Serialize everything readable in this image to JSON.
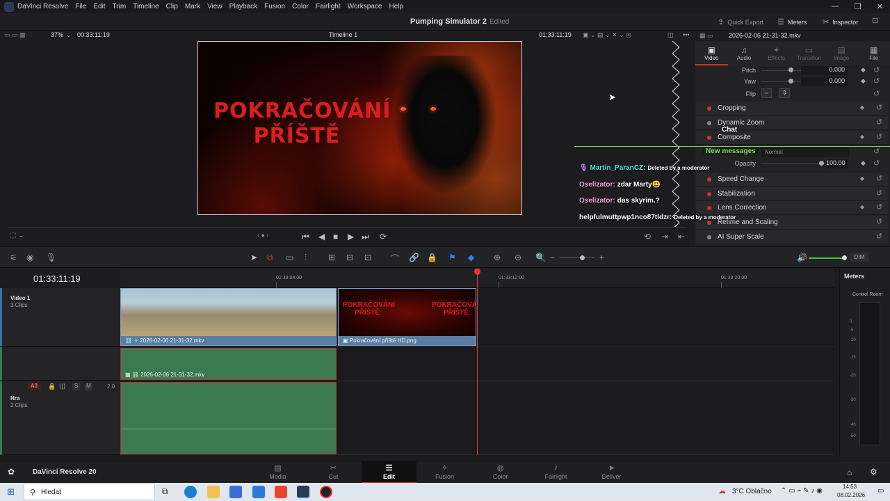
{
  "app": {
    "name": "DaVinci Resolve",
    "menu": [
      "File",
      "Edit",
      "Trim",
      "Timeline",
      "Clip",
      "Mark",
      "View",
      "Playback",
      "Fusion",
      "Color",
      "Fairlight",
      "Workspace",
      "Help"
    ]
  },
  "titlebar": {
    "project": "Pumping Simulator 2",
    "status": "Edited",
    "quick_export": "Quick Export",
    "meters": "Meters",
    "inspector": "Inspector"
  },
  "viewer": {
    "zoom": "37%",
    "timecode_left": "00:33:11:19",
    "timeline_name": "Timeline 1",
    "timecode_right": "01:33:11:19",
    "preview_text_line1": "POKRAČOVÁNÍ",
    "preview_text_line2": "PŘÍŠTĚ"
  },
  "inspector": {
    "clip_name": "2026-02-06 21-31-32.mkv",
    "tabs": [
      {
        "label": "Video",
        "glyph": "▣"
      },
      {
        "label": "Audio",
        "glyph": "♫"
      },
      {
        "label": "Effects",
        "glyph": "✦"
      },
      {
        "label": "Transition",
        "glyph": "▭"
      },
      {
        "label": "Image",
        "glyph": "▤"
      },
      {
        "label": "File",
        "glyph": "▦"
      }
    ],
    "pitch": {
      "label": "Pitch",
      "value": "0.000"
    },
    "yaw": {
      "label": "Yaw",
      "value": "0.000"
    },
    "flip": {
      "label": "Flip"
    },
    "opacity": {
      "label": "Opacity",
      "value": "100.00"
    },
    "composite_mode": "Normal",
    "sections": [
      "Cropping",
      "Dynamic Zoom",
      "Composite",
      "Speed Change",
      "Stabilization",
      "Lens Correction",
      "Retime and Scaling",
      "AI Super Scale"
    ]
  },
  "chat": {
    "title": "Chat",
    "new_messages": "New messages",
    "messages": [
      {
        "user": "Martin_ParanCZ:",
        "text": "Deleted by a moderator",
        "color": "#46e6e6"
      },
      {
        "user": "Oselizator:",
        "text": "zdar Marty😃",
        "color": "#ff9ad5"
      },
      {
        "user": "Oselizator:",
        "text": "das skyrim.?",
        "color": "#ff9ad5"
      },
      {
        "user": "helpfulmuttpwp1nco87tldzr:",
        "text": "Deleted by a moderator",
        "color": "#ffffff"
      }
    ]
  },
  "timeline": {
    "timecode": "01:33:11:19",
    "ruler": [
      "01:33:04:00",
      "01:33:12:00",
      "01:33:20:00"
    ],
    "tracks": [
      {
        "name": "Video 1",
        "count": "3 Clips"
      },
      {
        "name": "Hra",
        "count": "2 Clips",
        "badge": "A3",
        "s": "S",
        "m": "M",
        "level": "2.0"
      }
    ],
    "clips": {
      "v1a": "2026-02-06 21-31-32.mkv",
      "v1b": "Pokračování příště HD.png",
      "a1": "2026-02-06 21-31-32.mkv"
    },
    "thumb_text_line1": "POKRAČOVÁNÍ",
    "thumb_text_line2": "PŘÍŠTĚ"
  },
  "meters_panel": {
    "title": "Meters",
    "control_room": "Control Room",
    "scale": [
      "0",
      "-5",
      "-10",
      "-15",
      "-20",
      "-30",
      "-40",
      "-50"
    ]
  },
  "toolbar": {
    "dim": "DIM"
  },
  "pages": [
    {
      "label": "Media",
      "glyph": "▤"
    },
    {
      "label": "Cut",
      "glyph": "✂"
    },
    {
      "label": "Edit",
      "glyph": "☰"
    },
    {
      "label": "Fusion",
      "glyph": "✧"
    },
    {
      "label": "Color",
      "glyph": "◍"
    },
    {
      "label": "Fairlight",
      "glyph": "♪"
    },
    {
      "label": "Deliver",
      "glyph": "➤"
    }
  ],
  "brand": "DaVinci Resolve 20",
  "taskbar": {
    "search": "Hledat",
    "weather": "3°C  Oblačno",
    "time": "14:53",
    "date": "08.02.2026"
  },
  "colors": {
    "accent": "#d03030",
    "clip_blue": "#5a7fa3",
    "clip_green": "#3d7a52",
    "playhead": "#e33333",
    "new_messages": "#7ed957"
  }
}
